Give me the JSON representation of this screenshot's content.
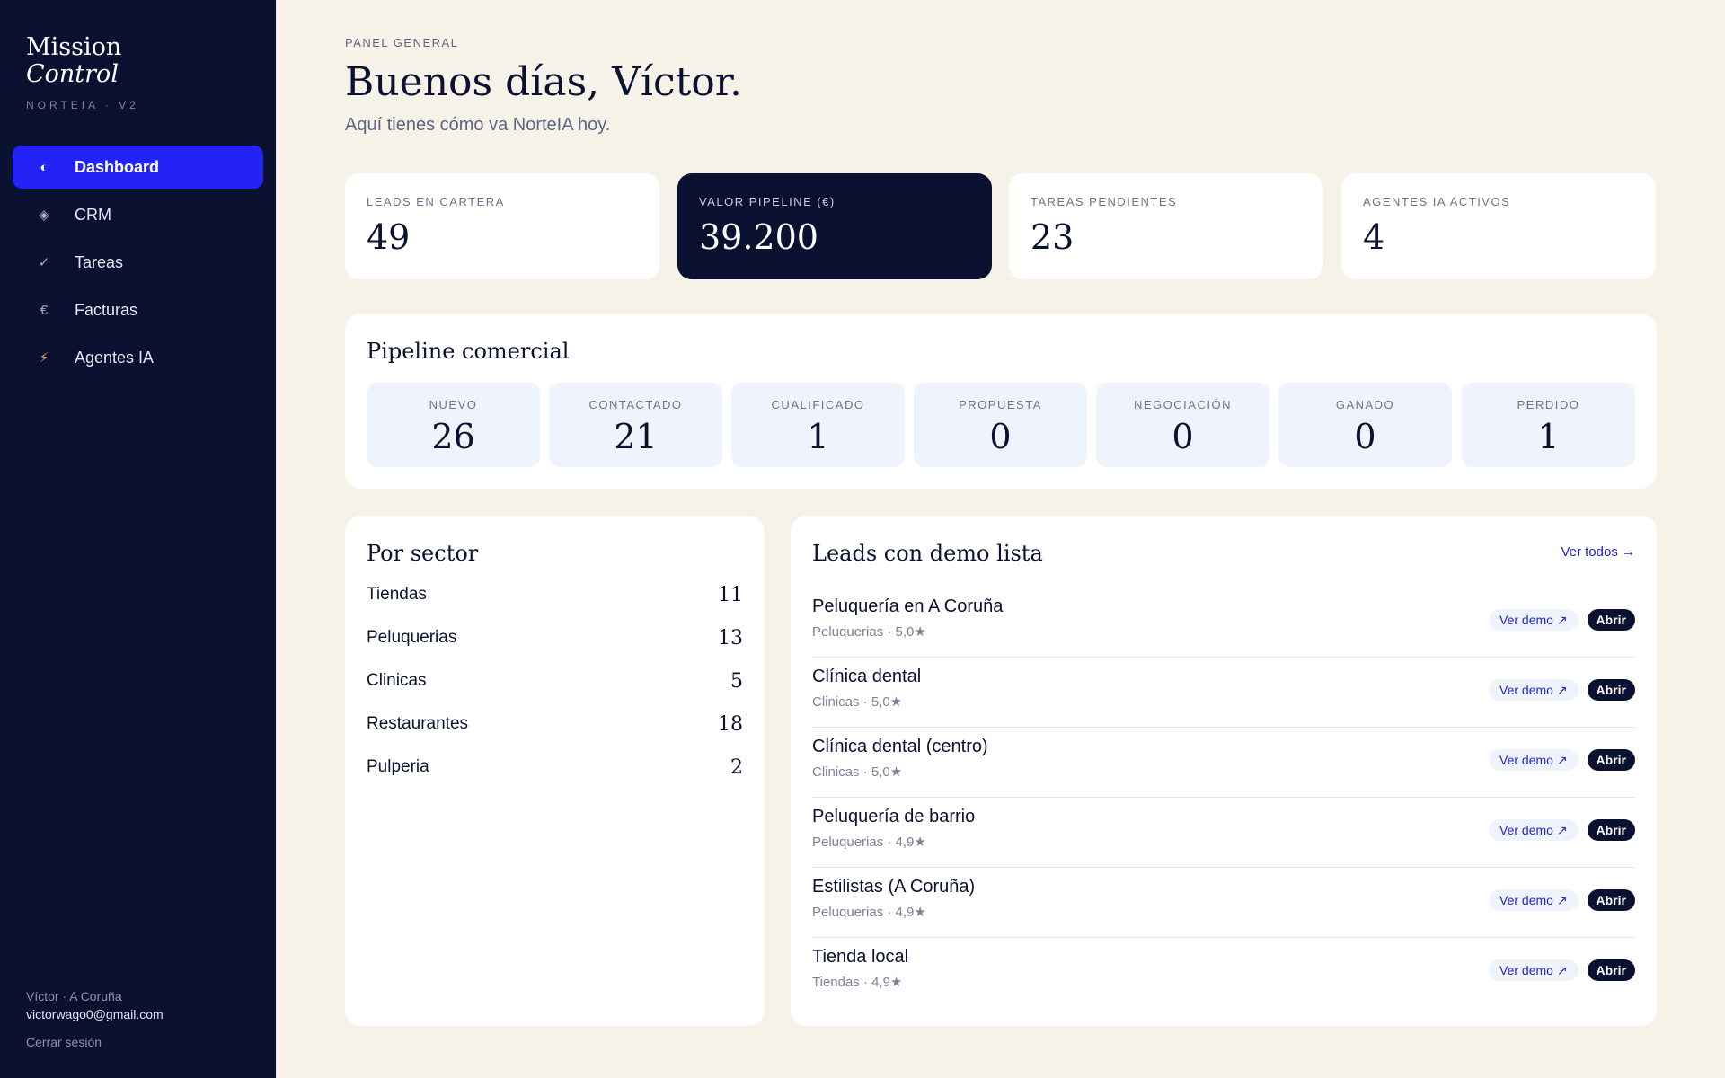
{
  "sidebar": {
    "brand_line1": "Mission",
    "brand_line2": "Control",
    "brand_sub": "NORTEIA · V2",
    "items": [
      {
        "label": "Dashboard",
        "icon": "◐",
        "icon_name": "dashboard-icon"
      },
      {
        "label": "CRM",
        "icon": "◈",
        "icon_name": "crm-icon"
      },
      {
        "label": "Tareas",
        "icon": "✓",
        "icon_name": "check-icon"
      },
      {
        "label": "Facturas",
        "icon": "€",
        "icon_name": "euro-icon"
      },
      {
        "label": "Agentes IA",
        "icon": "⚡",
        "icon_name": "bolt-icon"
      }
    ],
    "user_name": "Víctor · A Coruña",
    "user_email": "victorwago0@gmail.com",
    "logout": "Cerrar sesión"
  },
  "header": {
    "eyebrow": "PANEL GENERAL",
    "greeting": "Buenos días, Víctor.",
    "subtitle": "Aquí tienes cómo va NorteIA hoy."
  },
  "stats": [
    {
      "label": "LEADS EN CARTERA",
      "value": "49"
    },
    {
      "label": "VALOR PIPELINE (€)",
      "value": "39.200"
    },
    {
      "label": "TAREAS PENDIENTES",
      "value": "23"
    },
    {
      "label": "AGENTES IA ACTIVOS",
      "value": "4"
    }
  ],
  "pipeline": {
    "title": "Pipeline comercial",
    "stages": [
      {
        "label": "NUEVO",
        "value": "26"
      },
      {
        "label": "CONTACTADO",
        "value": "21"
      },
      {
        "label": "CUALIFICADO",
        "value": "1"
      },
      {
        "label": "PROPUESTA",
        "value": "0"
      },
      {
        "label": "NEGOCIACIÓN",
        "value": "0"
      },
      {
        "label": "GANADO",
        "value": "0"
      },
      {
        "label": "PERDIDO",
        "value": "1"
      }
    ]
  },
  "sectors": {
    "title": "Por sector",
    "rows": [
      {
        "name": "Tiendas",
        "count": "11"
      },
      {
        "name": "Peluquerias",
        "count": "13"
      },
      {
        "name": "Clinicas",
        "count": "5"
      },
      {
        "name": "Restaurantes",
        "count": "18"
      },
      {
        "name": "Pulperia",
        "count": "2"
      }
    ]
  },
  "demos": {
    "title": "Leads con demo lista",
    "see_all": "Ver todos →",
    "demo_label": "Ver demo ↗",
    "open_label": "Abrir",
    "rows": [
      {
        "name": "Peluquería en A Coruña",
        "meta": "Peluquerias · 5,0★"
      },
      {
        "name": "Clínica dental",
        "meta": "Clinicas · 5,0★"
      },
      {
        "name": "Clínica dental (centro)",
        "meta": "Clinicas · 5,0★"
      },
      {
        "name": "Peluquería de barrio",
        "meta": "Peluquerias · 4,9★"
      },
      {
        "name": "Estilistas (A Coruña)",
        "meta": "Peluquerias · 4,9★"
      },
      {
        "name": "Tienda local",
        "meta": "Tiendas · 4,9★"
      }
    ]
  },
  "colors": {
    "sidebar_bg": "#0b1131",
    "accent": "#2323f7",
    "page_bg": "#f6f2e8",
    "link": "#2525c8"
  }
}
